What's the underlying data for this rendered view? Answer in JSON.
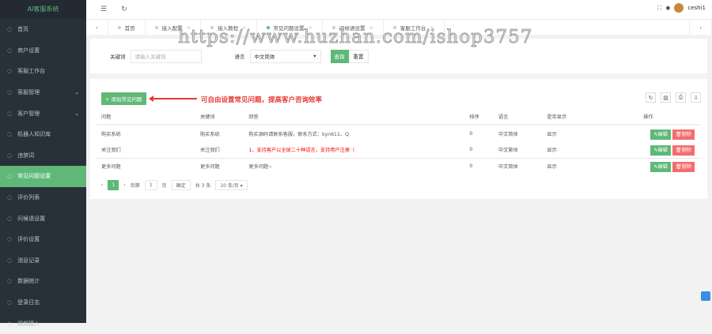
{
  "app": {
    "title": "AI客服系统",
    "user": "ceshi1"
  },
  "sidebar": {
    "items": [
      {
        "label": "首页",
        "icon": "home-icon"
      },
      {
        "label": "商户设置",
        "icon": "gear-icon"
      },
      {
        "label": "客服工作台",
        "icon": "gear-icon"
      },
      {
        "label": "客服管理",
        "icon": "user-icon",
        "chev": "⌄"
      },
      {
        "label": "客户管理",
        "icon": "users-icon",
        "chev": "⌄"
      },
      {
        "label": "机器人知识库",
        "icon": "robot-icon"
      },
      {
        "label": "违禁词",
        "icon": "shield-icon"
      },
      {
        "label": "常见问题设置",
        "icon": "question-icon"
      },
      {
        "label": "评价列表",
        "icon": "thumb-icon"
      },
      {
        "label": "问候语设置",
        "icon": "message-icon"
      },
      {
        "label": "评价设置",
        "icon": "star-icon"
      },
      {
        "label": "消息记录",
        "icon": "record-icon"
      },
      {
        "label": "数据统计",
        "icon": "chart-icon"
      },
      {
        "label": "登录日志",
        "icon": "log-icon"
      },
      {
        "label": "视频接入",
        "icon": "video-icon"
      }
    ]
  },
  "tabs": [
    {
      "label": "首页"
    },
    {
      "label": "接入配置"
    },
    {
      "label": "接入教程"
    },
    {
      "label": "常见问题设置"
    },
    {
      "label": "问候语设置"
    },
    {
      "label": "客服工作台"
    }
  ],
  "filter": {
    "keyword_label": "关键词",
    "keyword_placeholder": "请输入关键词",
    "lang_label": "语言",
    "lang_value": "中文简体",
    "search": "查询",
    "reset": "重置"
  },
  "toolbar": {
    "add": "+ 添加常见问题",
    "note": "可自由设置常见问题，提高客户咨询效率"
  },
  "table": {
    "headers": [
      "问题",
      "关键词",
      "回答",
      "排序",
      "语言",
      "是否显示",
      "操作"
    ],
    "rows": [
      {
        "q": "购买系统",
        "k": "购买系统",
        "a": "购买源码请联系客服，联系方式：kyn611、Q",
        "s": "0",
        "l": "中文简体",
        "v": "显示"
      },
      {
        "q": "关注我们",
        "k": "关注我们",
        "a": "1、支持客户以全球二十种语言，支持用户注册（",
        "s": "0",
        "l": "中文繁体",
        "v": "显示"
      },
      {
        "q": "更多问题",
        "k": "更多问题",
        "a": "更多问题~",
        "s": "0",
        "l": "中文简体",
        "v": "显示"
      }
    ],
    "edit": "✎编辑",
    "delete": "🗑删除"
  },
  "pager": {
    "page": "1",
    "goto": "到第",
    "goto_val": "1",
    "page_unit": "页",
    "confirm": "确定",
    "total": "共 3 条",
    "size": "10 条/页 ▾"
  },
  "watermark": "https://www.huzhan.com/ishop3757"
}
